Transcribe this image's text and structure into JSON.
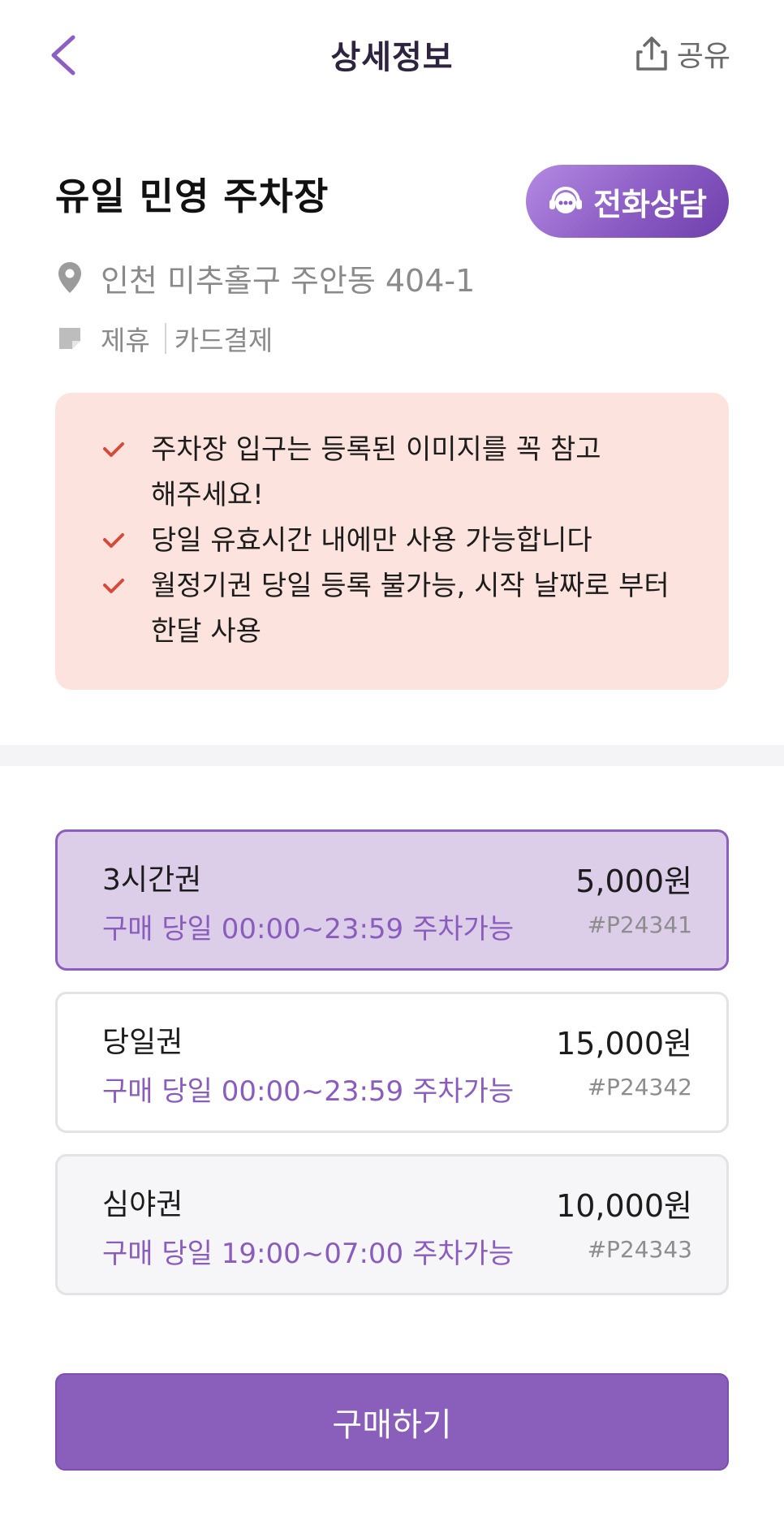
{
  "header": {
    "title": "상세정보",
    "share_label": "공유"
  },
  "lot": {
    "name": "유일 민영 주차장",
    "call_label": "전화상담",
    "address": "인천 미추홀구 주안동 404-1",
    "tags": [
      "제휴",
      "카드결제"
    ]
  },
  "notice": {
    "items": [
      "주차장 입구는 등록된 이미지를 꼭 참고해주세요!",
      "당일 유효시간 내에만 사용 가능합니다",
      "월정기권 당일 등록 불가능, 시작 날짜로 부터 한달 사용"
    ]
  },
  "tickets": [
    {
      "name": "3시간권",
      "price": "5,000원",
      "desc": "구매 당일 00:00~23:59 주차가능",
      "code": "#P24341",
      "selected": true
    },
    {
      "name": "당일권",
      "price": "15,000원",
      "desc": "구매 당일 00:00~23:59 주차가능",
      "code": "#P24342",
      "selected": false
    },
    {
      "name": "심야권",
      "price": "10,000원",
      "desc": "구매 당일 19:00~07:00 주차가능",
      "code": "#P24343",
      "selected": false
    }
  ],
  "purchase": {
    "label": "구매하기"
  },
  "colors": {
    "accent": "#8a5fbb",
    "notice_bg": "#fce3dd",
    "check": "#d64a3a",
    "selected_bg": "#dccde9"
  },
  "icons": {
    "back": "chevron-left-icon",
    "share": "share-upload-icon",
    "call": "headset-chat-icon",
    "location": "location-pin-icon",
    "tag": "sticky-note-icon",
    "check": "check-icon"
  }
}
